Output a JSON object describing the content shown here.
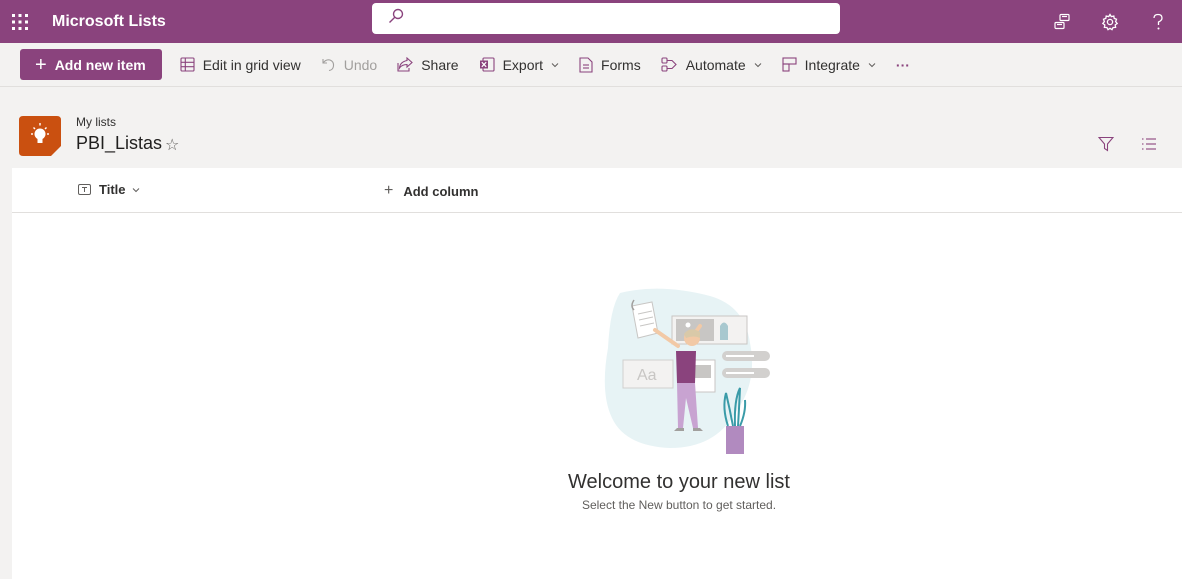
{
  "suite": {
    "app_name": "Microsoft Lists",
    "search_placeholder": ""
  },
  "command_bar": {
    "add_new_item": "Add new item",
    "edit_grid": "Edit in grid view",
    "undo": "Undo",
    "share": "Share",
    "export": "Export",
    "forms": "Forms",
    "automate": "Automate",
    "integrate": "Integrate",
    "more": "···"
  },
  "list": {
    "breadcrumb": "My lists",
    "title": "PBI_Listas",
    "star": "☆"
  },
  "columns": {
    "title": "Title",
    "add_column": "Add column"
  },
  "empty_state": {
    "heading": "Welcome to your new list",
    "subtext": "Select the New button to get started."
  },
  "colors": {
    "brand": "#8a437d",
    "list_icon": "#ca5010"
  }
}
